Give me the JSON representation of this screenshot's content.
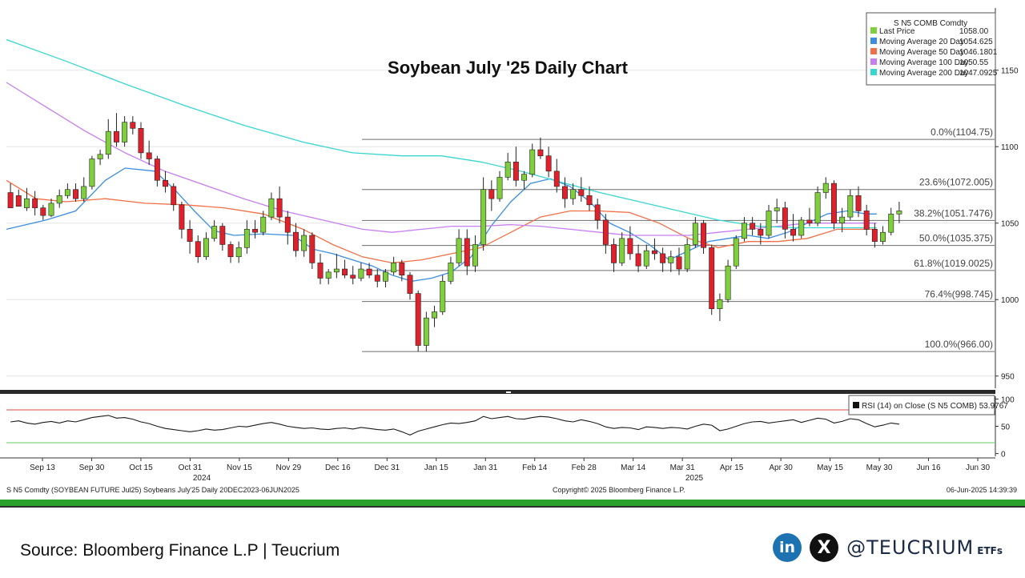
{
  "chart_data": {
    "type": "candlestick",
    "title": "Soybean July '25 Daily Chart",
    "price_axis": {
      "ticks": [
        950,
        1000,
        1050,
        1100,
        1150
      ],
      "range": [
        942,
        1175
      ]
    },
    "rsi_axis": {
      "ticks": [
        0,
        50,
        100
      ],
      "range": [
        -5,
        105
      ],
      "overbought": 80,
      "oversold": 20
    },
    "x_labels": [
      "Sep 13",
      "Sep 30",
      "Oct 15",
      "Oct 31",
      "Nov 15",
      "Nov 29",
      "Dec 16",
      "Dec 31",
      "Jan 15",
      "Jan 31",
      "Feb 14",
      "Feb 28",
      "Mar 14",
      "Mar 31",
      "Apr 15",
      "Apr 30",
      "May 15",
      "May 30",
      "Jun 16",
      "Jun 30"
    ],
    "year_labels": [
      "2024",
      "2025"
    ],
    "legend": {
      "title": "S N5 COMB Comdty",
      "entries": [
        {
          "name": "Last Price",
          "value": "1058.00",
          "color": "#7fcf3c"
        },
        {
          "name": "Moving Average 20 Day",
          "value": "1054.625",
          "color": "#3a8ee0"
        },
        {
          "name": "Moving Average 50 Day",
          "value": "1046.1801",
          "color": "#f06f45"
        },
        {
          "name": "Moving Average 100 Day",
          "value": "1050.55",
          "color": "#c77ef0"
        },
        {
          "name": "Moving Average 200 Day",
          "value": "1047.0925",
          "color": "#37d6cf"
        }
      ]
    },
    "fibonacci": [
      {
        "label": "0.0%(1104.75)",
        "value": 1104.75
      },
      {
        "label": "23.6%(1072.005)",
        "value": 1072.005
      },
      {
        "label": "38.2%(1051.7476)",
        "value": 1051.7476
      },
      {
        "label": "50.0%(1035.375)",
        "value": 1035.375
      },
      {
        "label": "61.8%(1019.0025)",
        "value": 1019.0025
      },
      {
        "label": "76.4%(998.745)",
        "value": 998.745
      },
      {
        "label": "100.0%(966.00)",
        "value": 966.0
      }
    ],
    "rsi_legend": "RSI (14)  on Close (S N5 COMB) 53.9767",
    "rsi_last": 53.9767,
    "series": [
      {
        "name": "Moving Average 20 Day",
        "color": "#3a8ee0",
        "points": [
          [
            0,
            1046
          ],
          [
            0.04,
            1052
          ],
          [
            0.07,
            1058
          ],
          [
            0.1,
            1078
          ],
          [
            0.12,
            1086
          ],
          [
            0.15,
            1084
          ],
          [
            0.17,
            1072
          ],
          [
            0.19,
            1058
          ],
          [
            0.21,
            1045
          ],
          [
            0.23,
            1042
          ],
          [
            0.26,
            1043
          ],
          [
            0.29,
            1042
          ],
          [
            0.31,
            1033
          ],
          [
            0.33,
            1030
          ],
          [
            0.35,
            1026
          ],
          [
            0.37,
            1022
          ],
          [
            0.39,
            1016
          ],
          [
            0.41,
            1012
          ],
          [
            0.43,
            1014
          ],
          [
            0.45,
            1018
          ],
          [
            0.47,
            1028
          ],
          [
            0.49,
            1048
          ],
          [
            0.51,
            1064
          ],
          [
            0.53,
            1076
          ],
          [
            0.55,
            1079
          ],
          [
            0.57,
            1074
          ],
          [
            0.59,
            1064
          ],
          [
            0.61,
            1050
          ],
          [
            0.63,
            1044
          ],
          [
            0.65,
            1036
          ],
          [
            0.67,
            1026
          ],
          [
            0.69,
            1032
          ],
          [
            0.71,
            1038
          ],
          [
            0.73,
            1040
          ],
          [
            0.75,
            1042
          ],
          [
            0.77,
            1040
          ],
          [
            0.79,
            1044
          ],
          [
            0.81,
            1050
          ],
          [
            0.83,
            1056
          ],
          [
            0.85,
            1058
          ],
          [
            0.87,
            1056
          ],
          [
            0.88,
            1056
          ]
        ]
      },
      {
        "name": "Moving Average 50 Day",
        "color": "#f06f45",
        "points": [
          [
            0,
            1078
          ],
          [
            0.03,
            1066
          ],
          [
            0.06,
            1064
          ],
          [
            0.1,
            1066
          ],
          [
            0.14,
            1063
          ],
          [
            0.18,
            1062
          ],
          [
            0.22,
            1060
          ],
          [
            0.26,
            1056
          ],
          [
            0.3,
            1046
          ],
          [
            0.33,
            1036
          ],
          [
            0.36,
            1028
          ],
          [
            0.39,
            1024
          ],
          [
            0.42,
            1026
          ],
          [
            0.45,
            1030
          ],
          [
            0.48,
            1034
          ],
          [
            0.51,
            1044
          ],
          [
            0.54,
            1054
          ],
          [
            0.57,
            1058
          ],
          [
            0.6,
            1058
          ],
          [
            0.63,
            1057
          ],
          [
            0.66,
            1050
          ],
          [
            0.69,
            1040
          ],
          [
            0.72,
            1034
          ],
          [
            0.75,
            1038
          ],
          [
            0.78,
            1038
          ],
          [
            0.81,
            1040
          ],
          [
            0.84,
            1046
          ],
          [
            0.86,
            1046
          ],
          [
            0.88,
            1046
          ]
        ]
      },
      {
        "name": "Moving Average 100 Day",
        "color": "#c77ef0",
        "points": [
          [
            0,
            1142
          ],
          [
            0.04,
            1126
          ],
          [
            0.08,
            1110
          ],
          [
            0.12,
            1096
          ],
          [
            0.16,
            1084
          ],
          [
            0.2,
            1075
          ],
          [
            0.24,
            1066
          ],
          [
            0.28,
            1058
          ],
          [
            0.32,
            1052
          ],
          [
            0.36,
            1046
          ],
          [
            0.39,
            1044
          ],
          [
            0.42,
            1046
          ],
          [
            0.45,
            1048
          ],
          [
            0.48,
            1048
          ],
          [
            0.51,
            1049
          ],
          [
            0.54,
            1048
          ],
          [
            0.57,
            1046
          ],
          [
            0.6,
            1044
          ],
          [
            0.63,
            1042
          ],
          [
            0.66,
            1042
          ],
          [
            0.69,
            1042
          ],
          [
            0.72,
            1044
          ],
          [
            0.75,
            1046
          ],
          [
            0.78,
            1048
          ],
          [
            0.81,
            1050
          ],
          [
            0.84,
            1050
          ],
          [
            0.86,
            1050
          ],
          [
            0.88,
            1050
          ]
        ]
      },
      {
        "name": "Moving Average 200 Day",
        "color": "#37d6cf",
        "points": [
          [
            0,
            1170
          ],
          [
            0.06,
            1156
          ],
          [
            0.12,
            1141
          ],
          [
            0.18,
            1127
          ],
          [
            0.24,
            1114
          ],
          [
            0.3,
            1103
          ],
          [
            0.35,
            1096
          ],
          [
            0.4,
            1094
          ],
          [
            0.44,
            1094
          ],
          [
            0.48,
            1090
          ],
          [
            0.52,
            1084
          ],
          [
            0.56,
            1077
          ],
          [
            0.6,
            1070
          ],
          [
            0.64,
            1064
          ],
          [
            0.68,
            1058
          ],
          [
            0.72,
            1052
          ],
          [
            0.76,
            1048
          ],
          [
            0.8,
            1047
          ],
          [
            0.84,
            1047
          ],
          [
            0.86,
            1047
          ],
          [
            0.88,
            1047
          ]
        ]
      }
    ],
    "candles": [
      [
        1070,
        1076,
        1066,
        1060
      ],
      [
        1068,
        1072,
        1064,
        1061
      ],
      [
        1060,
        1073,
        1058,
        1066
      ],
      [
        1066,
        1071,
        1055,
        1060
      ],
      [
        1060,
        1062,
        1052,
        1055
      ],
      [
        1055,
        1066,
        1054,
        1063
      ],
      [
        1063,
        1072,
        1060,
        1068
      ],
      [
        1068,
        1076,
        1066,
        1072
      ],
      [
        1072,
        1076,
        1064,
        1066
      ],
      [
        1066,
        1080,
        1064,
        1074
      ],
      [
        1074,
        1094,
        1072,
        1092
      ],
      [
        1092,
        1098,
        1088,
        1095
      ],
      [
        1095,
        1118,
        1092,
        1110
      ],
      [
        1110,
        1122,
        1100,
        1103
      ],
      [
        1103,
        1120,
        1100,
        1116
      ],
      [
        1116,
        1120,
        1108,
        1112
      ],
      [
        1112,
        1116,
        1092,
        1096
      ],
      [
        1096,
        1104,
        1088,
        1092
      ],
      [
        1092,
        1094,
        1074,
        1078
      ],
      [
        1078,
        1084,
        1070,
        1074
      ],
      [
        1074,
        1076,
        1058,
        1062
      ],
      [
        1062,
        1064,
        1040,
        1046
      ],
      [
        1046,
        1052,
        1030,
        1038
      ],
      [
        1038,
        1042,
        1024,
        1028
      ],
      [
        1028,
        1044,
        1026,
        1040
      ],
      [
        1040,
        1052,
        1038,
        1048
      ],
      [
        1048,
        1050,
        1032,
        1036
      ],
      [
        1036,
        1038,
        1024,
        1028
      ],
      [
        1028,
        1038,
        1024,
        1034
      ],
      [
        1034,
        1052,
        1030,
        1046
      ],
      [
        1046,
        1052,
        1040,
        1044
      ],
      [
        1044,
        1058,
        1042,
        1054
      ],
      [
        1054,
        1070,
        1052,
        1066
      ],
      [
        1066,
        1074,
        1050,
        1054
      ],
      [
        1054,
        1058,
        1036,
        1044
      ],
      [
        1044,
        1050,
        1028,
        1032
      ],
      [
        1032,
        1046,
        1028,
        1042
      ],
      [
        1042,
        1044,
        1020,
        1024
      ],
      [
        1024,
        1030,
        1010,
        1014
      ],
      [
        1014,
        1020,
        1010,
        1018
      ],
      [
        1018,
        1030,
        1014,
        1020
      ],
      [
        1020,
        1026,
        1014,
        1016
      ],
      [
        1016,
        1022,
        1010,
        1014
      ],
      [
        1014,
        1024,
        1012,
        1020
      ],
      [
        1020,
        1024,
        1014,
        1016
      ],
      [
        1016,
        1020,
        1008,
        1012
      ],
      [
        1012,
        1020,
        1008,
        1018
      ],
      [
        1018,
        1028,
        1016,
        1024
      ],
      [
        1024,
        1026,
        1012,
        1016
      ],
      [
        1016,
        1018,
        1000,
        1004
      ],
      [
        1004,
        1006,
        966,
        970
      ],
      [
        970,
        992,
        966,
        988
      ],
      [
        988,
        996,
        982,
        992
      ],
      [
        992,
        1016,
        990,
        1012
      ],
      [
        1012,
        1028,
        1010,
        1024
      ],
      [
        1024,
        1046,
        1022,
        1040
      ],
      [
        1040,
        1046,
        1016,
        1022
      ],
      [
        1022,
        1042,
        1018,
        1036
      ],
      [
        1036,
        1080,
        1032,
        1072
      ],
      [
        1072,
        1078,
        1058,
        1066
      ],
      [
        1066,
        1084,
        1064,
        1080
      ],
      [
        1080,
        1096,
        1078,
        1090
      ],
      [
        1090,
        1100,
        1074,
        1078
      ],
      [
        1078,
        1084,
        1072,
        1082
      ],
      [
        1082,
        1102,
        1080,
        1098
      ],
      [
        1098,
        1106,
        1092,
        1094
      ],
      [
        1094,
        1100,
        1080,
        1084
      ],
      [
        1084,
        1092,
        1070,
        1074
      ],
      [
        1074,
        1080,
        1060,
        1066
      ],
      [
        1066,
        1076,
        1062,
        1072
      ],
      [
        1072,
        1080,
        1064,
        1068
      ],
      [
        1068,
        1074,
        1058,
        1062
      ],
      [
        1062,
        1066,
        1046,
        1052
      ],
      [
        1052,
        1056,
        1030,
        1036
      ],
      [
        1036,
        1040,
        1018,
        1024
      ],
      [
        1024,
        1044,
        1022,
        1040
      ],
      [
        1040,
        1048,
        1026,
        1030
      ],
      [
        1030,
        1036,
        1018,
        1022
      ],
      [
        1022,
        1036,
        1020,
        1032
      ],
      [
        1032,
        1040,
        1026,
        1030
      ],
      [
        1030,
        1034,
        1018,
        1024
      ],
      [
        1024,
        1032,
        1018,
        1028
      ],
      [
        1028,
        1034,
        1016,
        1020
      ],
      [
        1020,
        1040,
        1018,
        1036
      ],
      [
        1036,
        1054,
        1034,
        1050
      ],
      [
        1050,
        1052,
        1030,
        1034
      ],
      [
        1034,
        1036,
        990,
        994
      ],
      [
        994,
        1004,
        986,
        1000
      ],
      [
        1000,
        1026,
        998,
        1022
      ],
      [
        1022,
        1042,
        1020,
        1040
      ],
      [
        1040,
        1054,
        1038,
        1050
      ],
      [
        1050,
        1054,
        1042,
        1046
      ],
      [
        1046,
        1050,
        1036,
        1042
      ],
      [
        1042,
        1062,
        1040,
        1058
      ],
      [
        1058,
        1066,
        1050,
        1060
      ],
      [
        1060,
        1064,
        1040,
        1046
      ],
      [
        1046,
        1056,
        1038,
        1042
      ],
      [
        1042,
        1054,
        1040,
        1052
      ],
      [
        1052,
        1060,
        1048,
        1050
      ],
      [
        1050,
        1074,
        1048,
        1070
      ],
      [
        1070,
        1080,
        1066,
        1076
      ],
      [
        1076,
        1078,
        1046,
        1050
      ],
      [
        1050,
        1060,
        1044,
        1054
      ],
      [
        1054,
        1072,
        1052,
        1068
      ],
      [
        1068,
        1074,
        1054,
        1058
      ],
      [
        1058,
        1062,
        1042,
        1046
      ],
      [
        1046,
        1050,
        1034,
        1038
      ],
      [
        1038,
        1048,
        1036,
        1044
      ],
      [
        1044,
        1060,
        1042,
        1056
      ],
      [
        1056,
        1064,
        1050,
        1058
      ]
    ],
    "rsi": [
      58,
      60,
      56,
      54,
      57,
      59,
      56,
      60,
      58,
      62,
      66,
      68,
      70,
      65,
      66,
      63,
      58,
      55,
      50,
      46,
      44,
      42,
      40,
      42,
      45,
      43,
      44,
      47,
      50,
      49,
      52,
      55,
      57,
      54,
      50,
      48,
      46,
      47,
      45,
      44,
      46,
      47,
      45,
      48,
      46,
      44,
      43,
      45,
      40,
      34,
      41,
      45,
      49,
      53,
      56,
      55,
      57,
      60,
      68,
      64,
      66,
      68,
      64,
      63,
      66,
      68,
      67,
      64,
      60,
      58,
      62,
      59,
      55,
      49,
      46,
      48,
      47,
      44,
      49,
      48,
      46,
      48,
      47,
      45,
      50,
      54,
      52,
      42,
      45,
      50,
      55,
      58,
      59,
      56,
      58,
      60,
      62,
      57,
      61,
      65,
      63,
      56,
      59,
      64,
      62,
      55,
      49,
      52,
      56,
      54
    ]
  },
  "info": {
    "bottom_left": "S N5 Comdty (SOYBEAN FUTURE   Jul25) Soybeans July'25  Daily 20DEC2023-06JUN2025",
    "bottom_center": "Copyright© 2025 Bloomberg Finance L.P.",
    "bottom_right": "06-Jun-2025 14:39:39"
  },
  "footer": {
    "source": "Source: Bloomberg Finance L.P | Teucrium",
    "handle": "@TEUCRIUM",
    "handle_suffix": "ETFs",
    "linkedin_glyph": "in",
    "x_glyph": "X"
  },
  "colors": {
    "up": "#7fcf3c",
    "down": "#e0202a",
    "fib_line": "#6e6e6e",
    "rsi_line": "#1a1a1a",
    "rsi_upper": "#e14a4a",
    "rsi_lower": "#5fcf5f",
    "separator": "#2aa12a"
  }
}
